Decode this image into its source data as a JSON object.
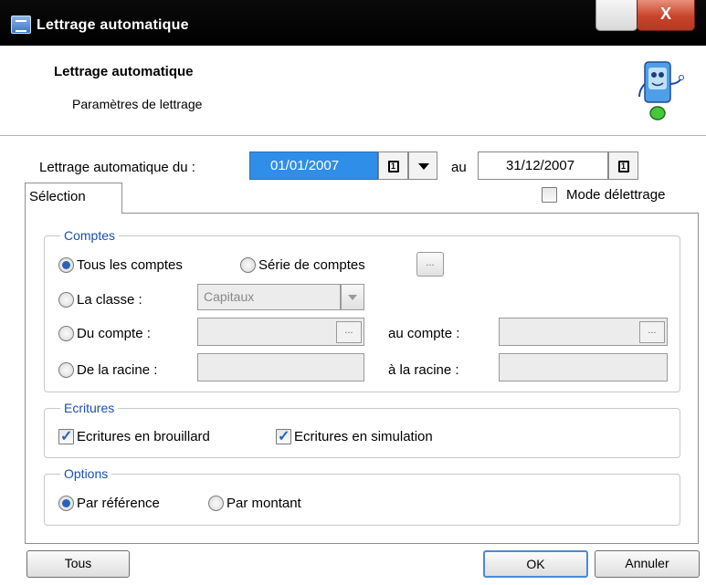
{
  "window": {
    "title": "Lettrage automatique",
    "close_glyph": "X"
  },
  "header": {
    "title": "Lettrage automatique",
    "subtitle": "Paramètres de lettrage"
  },
  "dates": {
    "label": "Lettrage automatique du :",
    "from": "01/01/2007",
    "to_label": "au",
    "to": "31/12/2007",
    "calendar_glyph": "1"
  },
  "tabs": [
    {
      "label": "Sélection",
      "active": true
    }
  ],
  "mode_delettrage": {
    "label": "Mode délettrage",
    "checked": false
  },
  "comptes": {
    "legend": "Comptes",
    "tous": "Tous les comptes",
    "serie": "Série de comptes",
    "classe_label": "La classe :",
    "classe_value": "Capitaux",
    "du_compte": "Du compte :",
    "au_compte": "au compte :",
    "de_racine": "De la racine :",
    "a_racine": "à la racine :",
    "dots": "...",
    "selected": "tous"
  },
  "ecritures": {
    "legend": "Ecritures",
    "brouillard": "Ecritures en brouillard",
    "brouillard_checked": true,
    "simulation": "Ecritures en simulation",
    "simulation_checked": true
  },
  "options": {
    "legend": "Options",
    "reference": "Par référence",
    "montant": "Par montant",
    "selected": "reference"
  },
  "buttons": {
    "tous": "Tous",
    "ok": "OK",
    "annuler": "Annuler"
  },
  "colors": {
    "accent": "#2f8ee8",
    "legend": "#1a4fb0",
    "check": "#2a62b8"
  }
}
